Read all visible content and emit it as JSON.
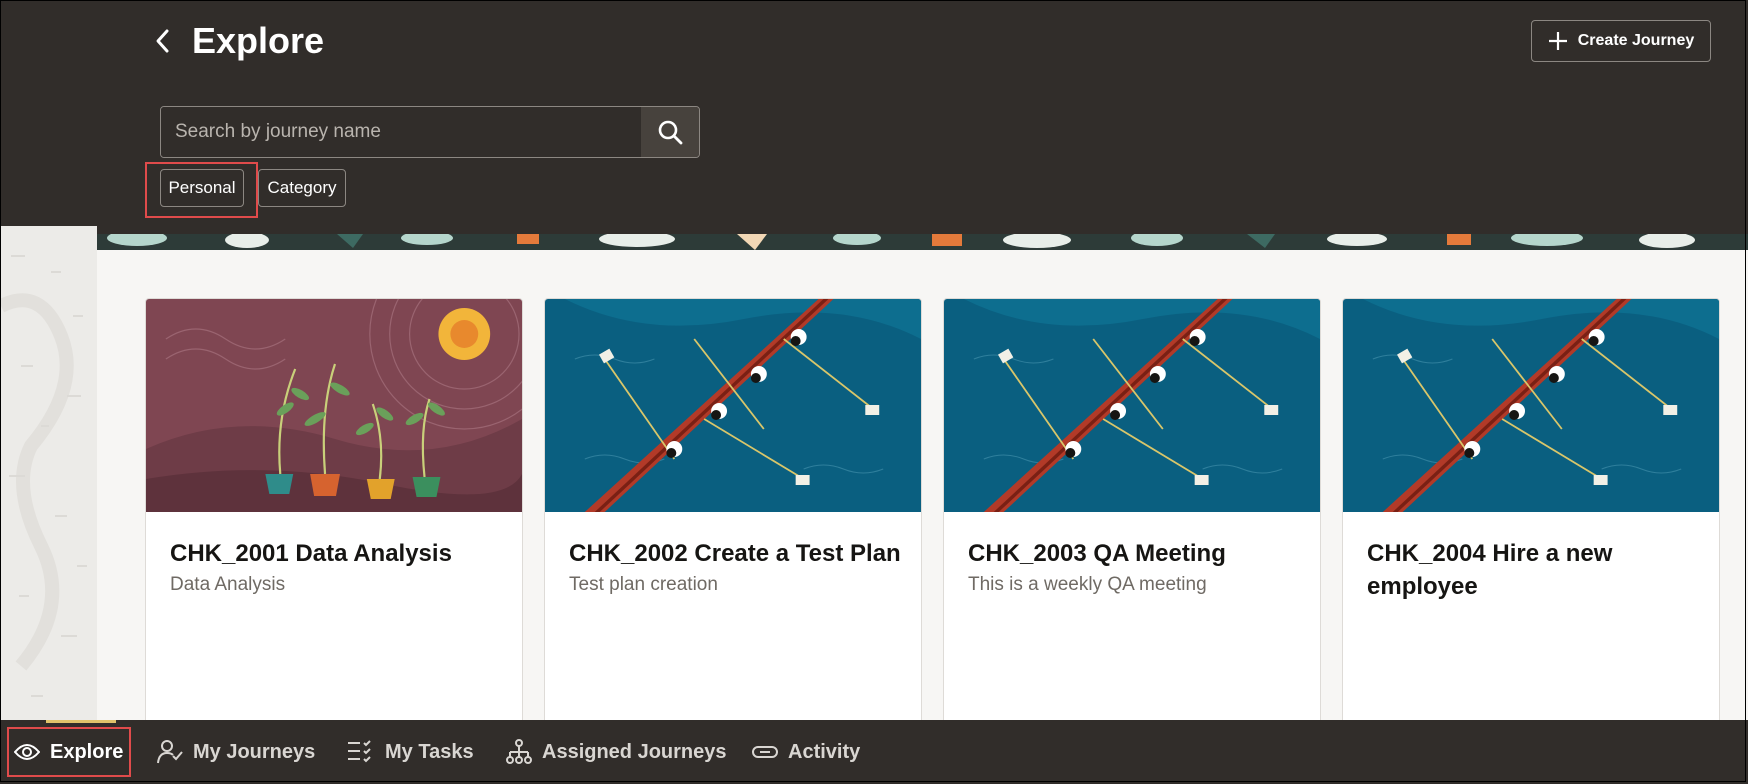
{
  "header": {
    "title": "Explore",
    "create_button_label": "Create Journey",
    "search_placeholder": "Search by journey name",
    "filters": [
      {
        "label": "Personal"
      },
      {
        "label": "Category"
      }
    ]
  },
  "cards": [
    {
      "title": "CHK_2001 Data Analysis",
      "description": "Data Analysis",
      "image": "plants-sun-illustration"
    },
    {
      "title": "CHK_2002 Create a Test Plan",
      "description": "Test plan creation",
      "image": "rowing-boat-illustration"
    },
    {
      "title": "CHK_2003 QA Meeting",
      "description": "This is a weekly QA meeting",
      "image": "rowing-boat-illustration"
    },
    {
      "title": "CHK_2004 Hire a new employee",
      "description": "",
      "image": "rowing-boat-illustration"
    }
  ],
  "bottom_nav": {
    "items": [
      {
        "label": "Explore",
        "icon": "eye-icon",
        "active": true
      },
      {
        "label": "My Journeys",
        "icon": "person-check-icon"
      },
      {
        "label": "My Tasks",
        "icon": "checklist-icon"
      },
      {
        "label": "Assigned Journeys",
        "icon": "hierarchy-icon"
      },
      {
        "label": "Activity",
        "icon": "link-icon"
      }
    ]
  },
  "colors": {
    "header_bg": "#312d2a",
    "content_bg": "#f7f6f4",
    "highlight": "#e04b4b",
    "active_indicator": "#e0c36a",
    "card_maroon": "#7f4652",
    "card_blue": "#0a5f80"
  }
}
